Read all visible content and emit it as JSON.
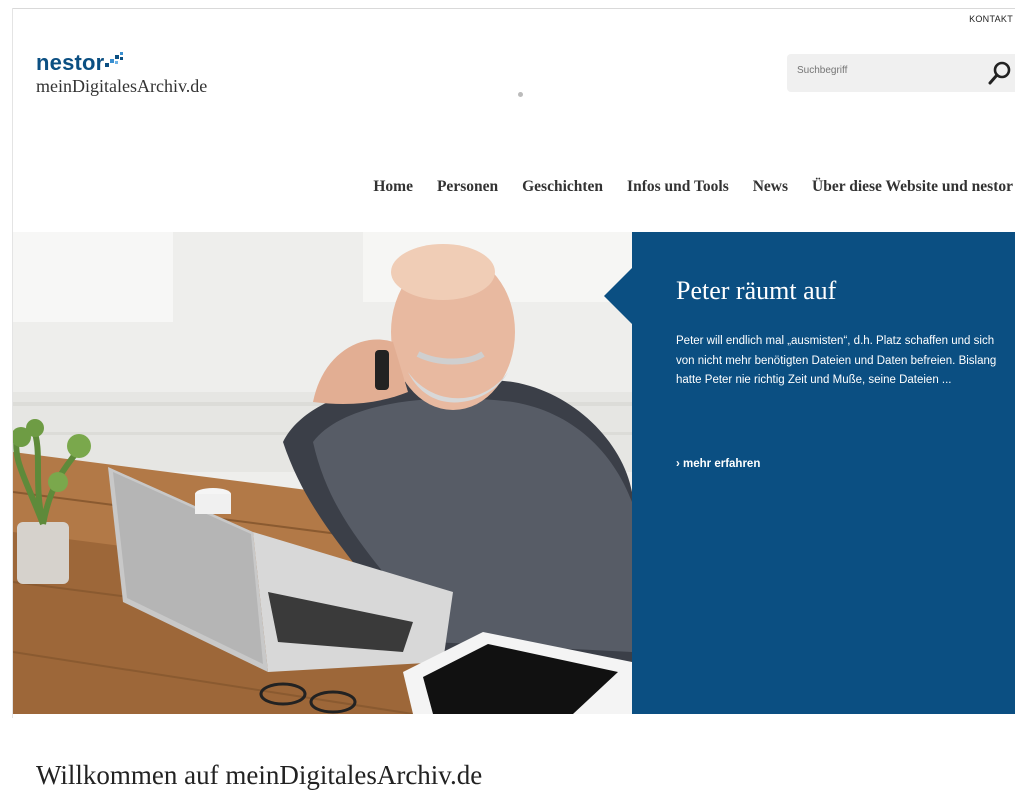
{
  "header": {
    "kontakt_label": "KONTAKT",
    "logo_word": "nestor",
    "logo_subtitle": "meinDigitalesArchiv.de",
    "search_placeholder": "Suchbegriff"
  },
  "nav": {
    "items": [
      {
        "label": "Home"
      },
      {
        "label": "Personen"
      },
      {
        "label": "Geschichten"
      },
      {
        "label": "Infos und Tools"
      },
      {
        "label": "News"
      },
      {
        "label": "Über diese Website und nestor"
      }
    ]
  },
  "hero": {
    "title": "Peter räumt auf",
    "text": "Peter will endlich mal „ausmisten“, d.h. Platz schaffen und sich von nicht mehr benötigten Dateien und Daten befreien. Bislang hatte Peter nie richtig Zeit und Muße, seine Dateien ...",
    "more_label": "› mehr erfahren"
  },
  "main": {
    "welcome_title": "Willkommen auf meinDigitalesArchiv.de"
  },
  "colors": {
    "brand_blue": "#0b4f82"
  }
}
